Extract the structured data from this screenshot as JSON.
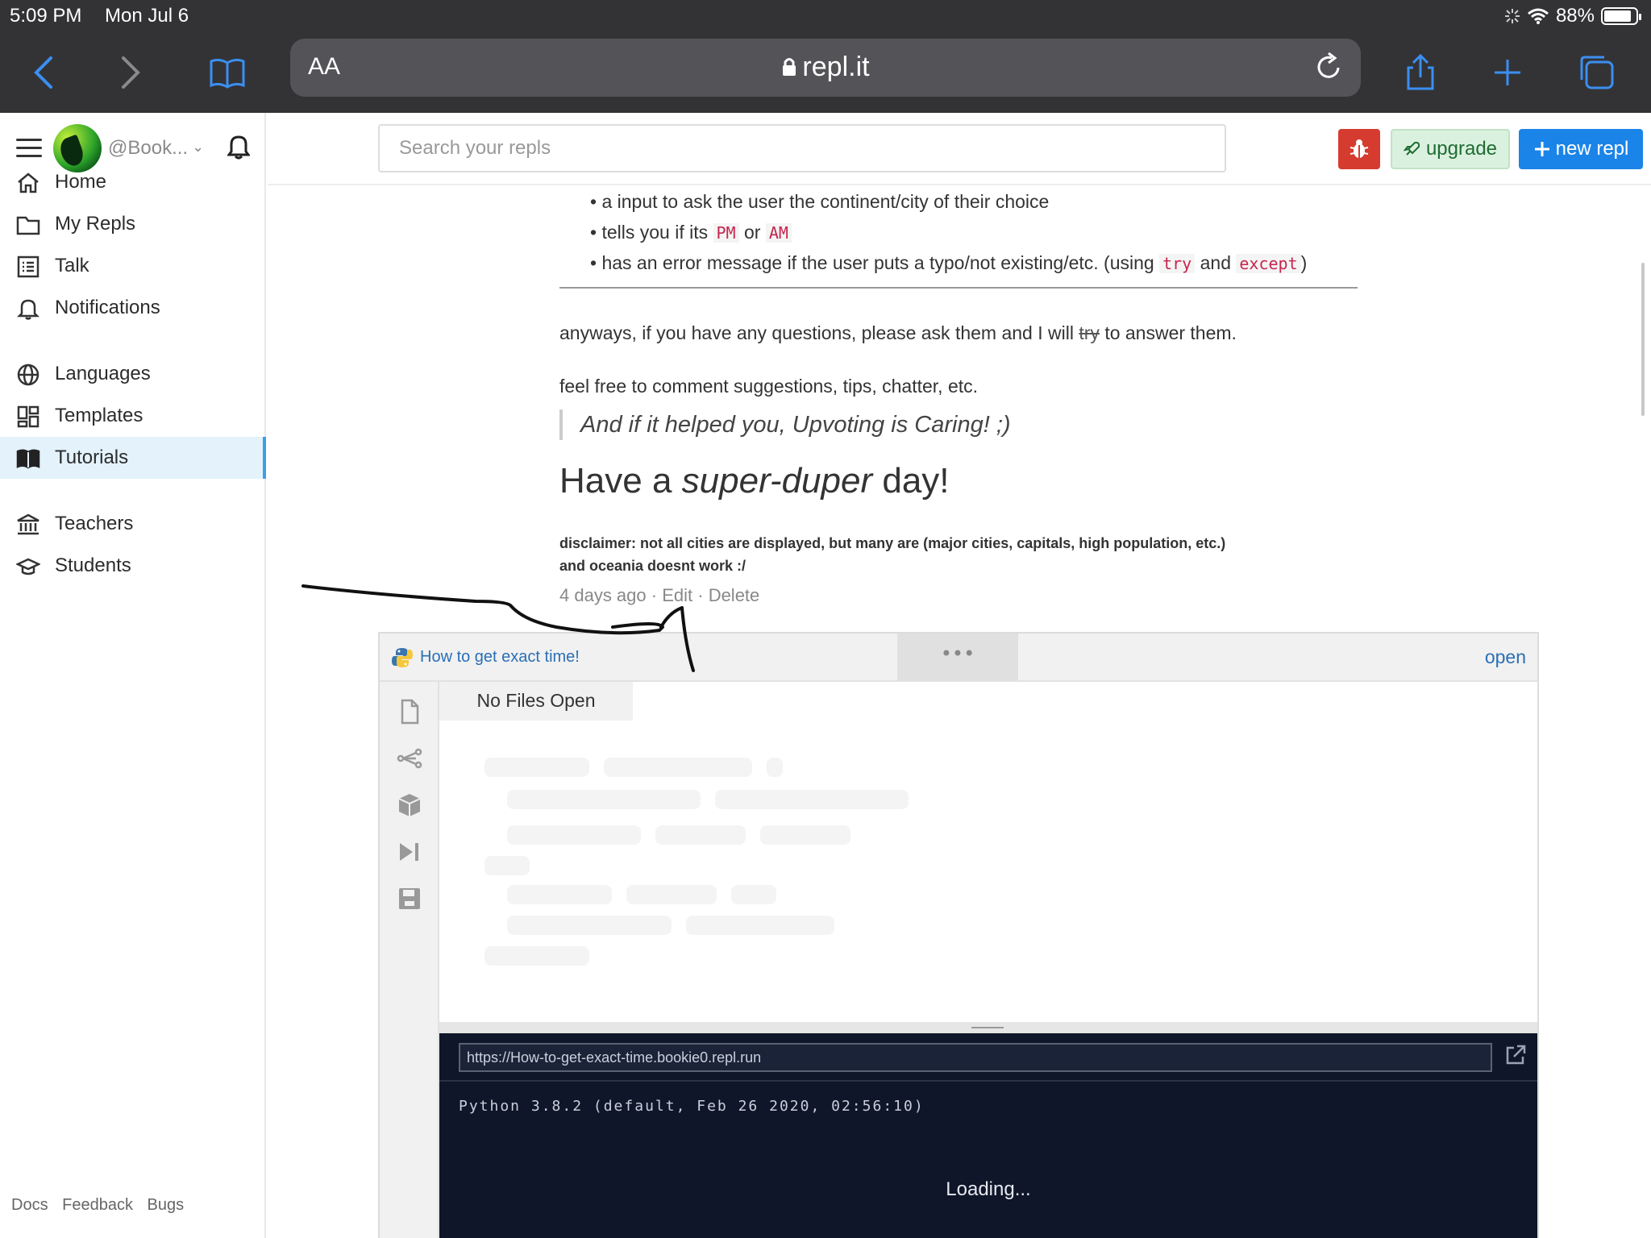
{
  "status_bar": {
    "time": "5:09 PM",
    "date": "Mon Jul 6",
    "battery": "88%",
    "battery_level": 0.88
  },
  "browser": {
    "text_size_label": "AA",
    "url": "repl.it"
  },
  "sidebar": {
    "username": "@Book...",
    "items": [
      {
        "label": "Home",
        "icon": "home-icon"
      },
      {
        "label": "My Repls",
        "icon": "folder-icon"
      },
      {
        "label": "Talk",
        "icon": "list-icon"
      },
      {
        "label": "Notifications",
        "icon": "bell-icon"
      },
      {
        "label": "Languages",
        "icon": "globe-icon"
      },
      {
        "label": "Templates",
        "icon": "grid-icon"
      },
      {
        "label": "Tutorials",
        "icon": "book-icon",
        "active": true
      },
      {
        "label": "Teachers",
        "icon": "bank-icon"
      },
      {
        "label": "Students",
        "icon": "graduation-cap-icon"
      }
    ],
    "footer": [
      "Docs",
      "Feedback",
      "Bugs"
    ]
  },
  "header": {
    "search_placeholder": "Search your repls",
    "upgrade_label": "upgrade",
    "new_repl_label": "new repl",
    "colors": {
      "bug": "#d53b2f",
      "upgrade_bg": "#dbf1df",
      "new_repl": "#1b84e8"
    }
  },
  "post": {
    "bullets": [
      {
        "text": "a input to ask the user the continent/city of their choice"
      },
      {
        "pre": "tells you if its",
        "code1": "PM",
        "mid": "or",
        "code2": "AM"
      },
      {
        "pre": "has an error message if the user puts a typo/not existing/etc. (using",
        "code1": "try",
        "mid": "and",
        "code2": "except",
        "post": ")"
      }
    ],
    "para1_pre": "anyways, if you have any questions, please ask them and I will",
    "para1_strike": "try",
    "para1_post": "to answer them.",
    "para2": "feel free to comment suggestions, tips, chatter, etc.",
    "quote": "And if it helped you, Upvoting is Caring! ;)",
    "heading_pre": "Have a",
    "heading_em": "super-duper",
    "heading_post": "day!",
    "disclaimer_line1": "disclaimer: not all cities are displayed, but many are (major cities, capitals, high population, etc.)",
    "disclaimer_line2": "and oceania doesnt work :/",
    "meta_time": "4 days ago",
    "meta_edit": "Edit",
    "meta_delete": "Delete"
  },
  "repl": {
    "title": "How to get exact time!",
    "dots": "•••",
    "open_label": "open",
    "no_files": "No Files Open",
    "run_url": "https://How-to-get-exact-time.bookie0.repl.run",
    "python_version": "Python 3.8.2 (default, Feb 26 2020, 02:56:10)",
    "loading": "Loading..."
  }
}
